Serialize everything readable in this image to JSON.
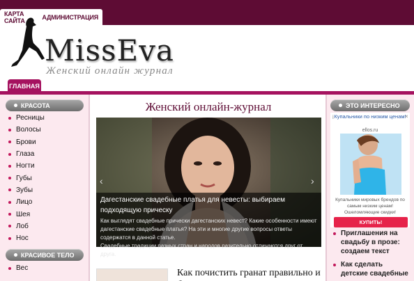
{
  "topnav": {
    "sitemap": "КАРТА САЙТА",
    "admin": "АДМИНИСТРАЦИЯ"
  },
  "logo": {
    "title": "MissEva",
    "subtitle": "Женский онлайн журнал"
  },
  "mainnav": {
    "home": "ГЛАВНАЯ"
  },
  "left": {
    "beauty_title": "КРАСОТА",
    "beauty_items": [
      "Ресницы",
      "Волосы",
      "Брови",
      "Глаза",
      "Ногти",
      "Губы",
      "Зубы",
      "Лицо",
      "Шея",
      "Лоб",
      "Нос"
    ],
    "body_title": "КРАСИВОЕ ТЕЛО",
    "body_items": [
      "Вес"
    ]
  },
  "main": {
    "title": "Женский онлайн-журнал",
    "slide": {
      "title": "Дагестанские свадебные платья для невесты: выбираем подходящую прическу",
      "desc": "Как выглядят свадебные прически дагестанских невест? Какие особенности имеют дагестанские свадебные платья? На эти и многие другие вопросы ответы содержатся в данной статье.",
      "extra": "Свадебные традиции разных стран и народов разительно отличаются друг от друга."
    },
    "article_title": "Как почистить гранат правильно и быстро в домашних условиях"
  },
  "right": {
    "title": "ЭТО ИНТЕРЕСНО",
    "ad": {
      "header": "Купальники по низким ценам!",
      "domain": "ellos.ru",
      "text": "Купальники мировых брендов по самым низким ценам! Ошеломляющие скидки!",
      "button": "КУПИТЬ!"
    },
    "links": [
      "Приглашения на свадьбу в прозе: создаем текст",
      "Как сделать детские свадебные"
    ]
  },
  "colors": {
    "brand": "#5e0c34",
    "accent": "#a5125f",
    "sidebar_bg": "#fce9ef",
    "button": "#e6234a"
  },
  "icons": {
    "arrow_left": "‹",
    "arrow_right": "›",
    "ad_info": "i",
    "ad_close": "×"
  }
}
